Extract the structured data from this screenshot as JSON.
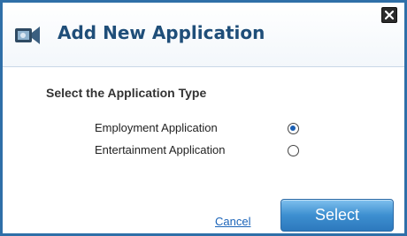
{
  "dialog": {
    "title": "Add New Application",
    "close_icon": "close-icon",
    "app_icon": "app-icon"
  },
  "form": {
    "prompt": "Select the Application Type",
    "options": [
      {
        "label": "Employment Application",
        "selected": true
      },
      {
        "label": "Entertainment Application",
        "selected": false
      }
    ]
  },
  "actions": {
    "cancel_label": "Cancel",
    "select_label": "Select"
  },
  "colors": {
    "border": "#2f6fa8",
    "title": "#1f4e79",
    "link": "#1a63b8",
    "button": "#3d8fd0"
  }
}
